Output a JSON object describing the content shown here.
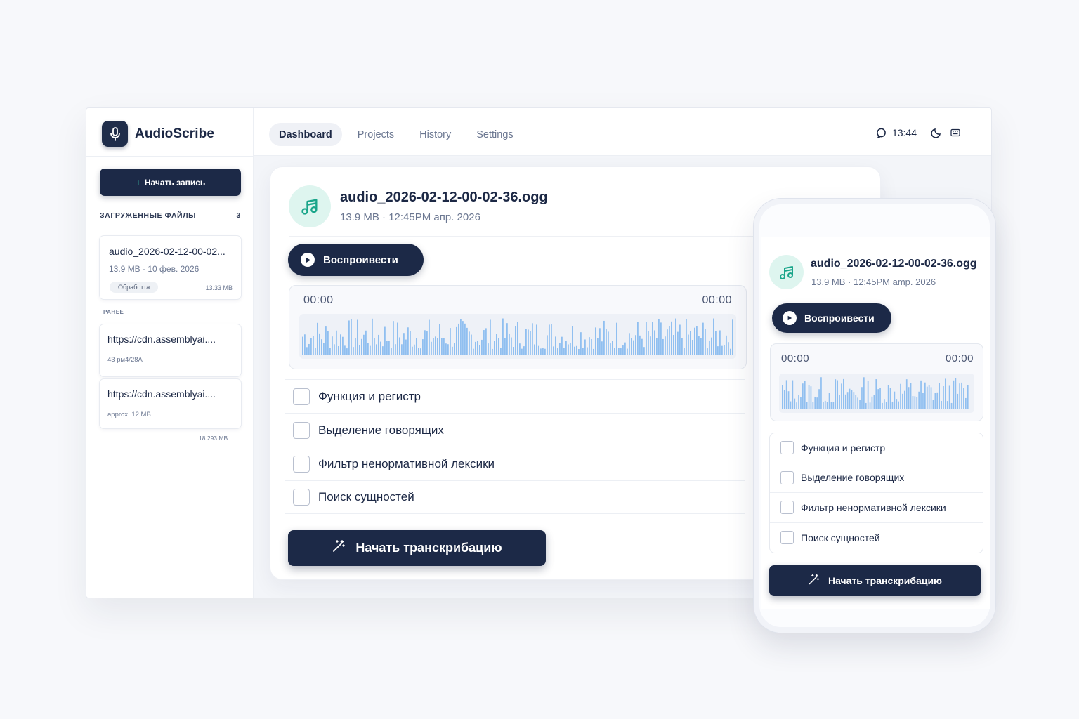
{
  "app": {
    "name": "AudioScribe"
  },
  "colors": {
    "primary": "#1c2947",
    "accent": "#3bc4a8",
    "wave": "#90bff0",
    "background": "#f7f8fb"
  },
  "icons": {
    "logo": "microphone-icon",
    "file": "music-note-icon",
    "play": "play-icon",
    "transcribe": "magic-wand-icon",
    "clock": "clock-icon",
    "theme": "moon-icon",
    "keyboard": "keyboard-icon"
  },
  "sidebar": {
    "new_recording": "Начать запись",
    "uploaded_label": "ЗАГРУЖЕННЫЕ ФАЙЛЫ",
    "uploaded_count": "3",
    "active_file": {
      "name": "audio_2026-02-12-00-02...",
      "meta": "13.9 MB · 10 фев. 2026",
      "badge": "Обработта",
      "size": "13.33 MB"
    },
    "earlier_label": "РАНЕЕ",
    "earlier_files": [
      {
        "url": "https://cdn.assemblyai....",
        "sub": "43 рм4/28А"
      },
      {
        "url": "https://cdn.assemblyai....",
        "sub": "approx. 12 MB"
      }
    ],
    "footnote": "18.293 MB"
  },
  "nav": {
    "tabs": [
      {
        "label": "Dashboard",
        "active": true
      },
      {
        "label": "Projects",
        "active": false
      },
      {
        "label": "History",
        "active": false
      },
      {
        "label": "Settings",
        "active": false
      }
    ],
    "time": "13:44"
  },
  "main": {
    "file_name": "audio_2026-02-12-00-02-36.ogg",
    "file_meta": "13.9 MB · 12:45PM апр. 2026",
    "play_label": "Воспроивести",
    "time_start": "00:00",
    "time_end": "00:00",
    "options": [
      {
        "label": "Функция и регистр",
        "checked": false
      },
      {
        "label": "Выделение говорящих",
        "checked": false
      },
      {
        "label": "Фильтр ненормативной лексики",
        "checked": false
      },
      {
        "label": "Поиск сущностей",
        "checked": false
      }
    ],
    "start_label": "Начать транскрибацию"
  },
  "mobile": {
    "file_name": "audio_2026-02-12-00-02-36.ogg",
    "file_meta": "13.9 MB · 12:45PM amp. 2026",
    "play_label": "Воспроивести",
    "time_start": "00:00",
    "time_end": "00:00",
    "options": [
      {
        "label": "Функция и регистр"
      },
      {
        "label": "Выделение говорящих"
      },
      {
        "label": "Фильтр ненормативной лексики"
      },
      {
        "label": "Поиск сущностей"
      }
    ],
    "start_label": "Начать транскрибацию"
  }
}
